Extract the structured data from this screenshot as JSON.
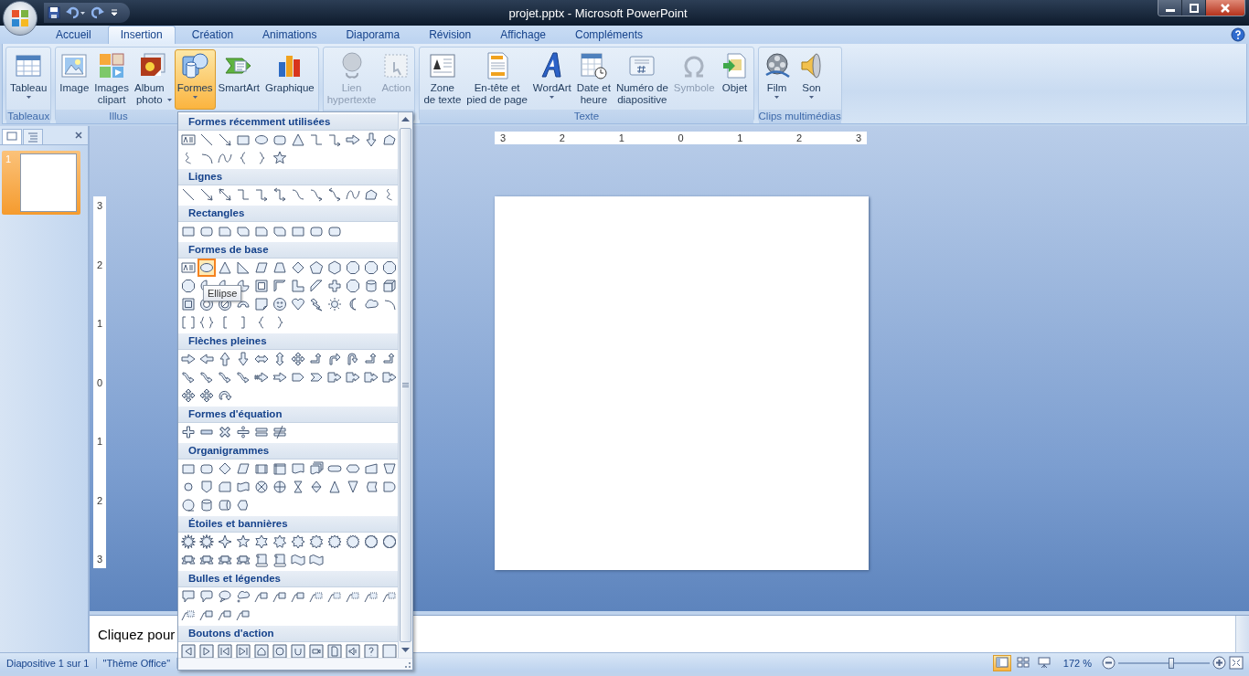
{
  "window": {
    "title": "projet.pptx - Microsoft PowerPoint"
  },
  "tabs": [
    {
      "label": "Accueil",
      "selected": false
    },
    {
      "label": "Insertion",
      "selected": true
    },
    {
      "label": "Création",
      "selected": false
    },
    {
      "label": "Animations",
      "selected": false
    },
    {
      "label": "Diaporama",
      "selected": false
    },
    {
      "label": "Révision",
      "selected": false
    },
    {
      "label": "Affichage",
      "selected": false
    },
    {
      "label": "Compléments",
      "selected": false
    }
  ],
  "ribbon": {
    "groups": [
      {
        "label": "Tableaux",
        "buttons": [
          {
            "kind": "table",
            "label": "Tableau",
            "has_menu": true,
            "disabled": false,
            "selected": false
          }
        ]
      },
      {
        "label": "Illus",
        "buttons": [
          {
            "kind": "picture",
            "label": "Image",
            "has_menu": false,
            "disabled": false,
            "selected": false
          },
          {
            "kind": "clipart",
            "label": "Images\nclipart",
            "has_menu": false,
            "disabled": false,
            "selected": false
          },
          {
            "kind": "album",
            "label": "Album\nphoto",
            "has_menu": true,
            "disabled": false,
            "selected": false
          },
          {
            "kind": "shapes",
            "label": "Formes",
            "has_menu": true,
            "disabled": false,
            "selected": true
          },
          {
            "kind": "smartart",
            "label": "SmartArt",
            "has_menu": false,
            "disabled": false,
            "selected": false
          },
          {
            "kind": "chart",
            "label": "Graphique",
            "has_menu": false,
            "disabled": false,
            "selected": false
          }
        ]
      },
      {
        "buttons": [
          {
            "kind": "link",
            "label": "Lien\nhypertexte",
            "has_menu": false,
            "disabled": true,
            "selected": false
          },
          {
            "kind": "action",
            "label": "Action",
            "has_menu": false,
            "disabled": true,
            "selected": false
          }
        ]
      },
      {
        "label": "Texte",
        "buttons": [
          {
            "kind": "textbox",
            "label": "Zone\nde texte",
            "has_menu": false,
            "disabled": false,
            "selected": false
          },
          {
            "kind": "header",
            "label": "En-tête et\npied de page",
            "has_menu": false,
            "disabled": false,
            "selected": false
          },
          {
            "kind": "wordart",
            "label": "WordArt",
            "has_menu": true,
            "disabled": false,
            "selected": false
          },
          {
            "kind": "date",
            "label": "Date et\nheure",
            "has_menu": false,
            "disabled": false,
            "selected": false
          },
          {
            "kind": "number",
            "label": "Numéro de\ndiapositive",
            "has_menu": false,
            "disabled": false,
            "selected": false
          },
          {
            "kind": "symbol",
            "label": "Symbole",
            "has_menu": false,
            "disabled": true,
            "selected": false
          },
          {
            "kind": "object",
            "label": "Objet",
            "has_menu": false,
            "disabled": false,
            "selected": false
          }
        ]
      },
      {
        "label": "Clips multimédias",
        "buttons": [
          {
            "kind": "movie",
            "label": "Film",
            "has_menu": true,
            "disabled": false,
            "selected": false
          },
          {
            "kind": "sound",
            "label": "Son",
            "has_menu": true,
            "disabled": false,
            "selected": false
          }
        ]
      }
    ]
  },
  "slides_panel": {
    "tabs": [
      {
        "kind": "slides",
        "selected": true
      },
      {
        "kind": "outline",
        "selected": false
      }
    ],
    "slides": [
      {
        "number": "1",
        "selected": true
      }
    ]
  },
  "editor": {
    "ruler_horizontal": [
      "3",
      "2",
      "1",
      "0",
      "1",
      "2",
      "3"
    ],
    "ruler_vertical": [
      "3",
      "2",
      "1",
      "0",
      "1",
      "2",
      "3"
    ]
  },
  "notes": {
    "prompt": "Cliquez pour"
  },
  "gallery": {
    "tooltip": "Ellipse",
    "sections": [
      {
        "title": "Formes récemment utilisées",
        "shapes": [
          {
            "kind": "textbox",
            "selected": false
          },
          {
            "kind": "line",
            "selected": false
          },
          {
            "kind": "arrow",
            "selected": false
          },
          {
            "kind": "rect",
            "selected": false
          },
          {
            "kind": "ellipse",
            "selected": false
          },
          {
            "kind": "rrect",
            "selected": false
          },
          {
            "kind": "triangle",
            "selected": false
          },
          {
            "kind": "elbow",
            "selected": false
          },
          {
            "kind": "elbowarrow",
            "selected": false
          },
          {
            "kind": "arrowright",
            "selected": false
          },
          {
            "kind": "arrowdown",
            "selected": false
          },
          {
            "kind": "freeform",
            "selected": false
          },
          {
            "kind": "scribble",
            "selected": false
          },
          {
            "kind": "arc",
            "selected": false
          },
          {
            "kind": "curve",
            "selected": false
          },
          {
            "kind": "lbrace",
            "selected": false
          },
          {
            "kind": "rbrace",
            "selected": false
          },
          {
            "kind": "star",
            "selected": false
          }
        ]
      },
      {
        "title": "Lignes",
        "shapes": [
          {
            "kind": "line",
            "selected": false
          },
          {
            "kind": "arrow",
            "selected": false
          },
          {
            "kind": "dblarrow",
            "selected": false
          },
          {
            "kind": "elbow",
            "selected": false
          },
          {
            "kind": "elbowarrow",
            "selected": false
          },
          {
            "kind": "elbowdbl",
            "selected": false
          },
          {
            "kind": "curved",
            "selected": false
          },
          {
            "kind": "curvedarrow",
            "selected": false
          },
          {
            "kind": "curveddbl",
            "selected": false
          },
          {
            "kind": "curve",
            "selected": false
          },
          {
            "kind": "freeform",
            "selected": false
          },
          {
            "kind": "scribble",
            "selected": false
          }
        ]
      },
      {
        "title": "Rectangles",
        "shapes": [
          {
            "kind": "rect",
            "selected": false
          },
          {
            "kind": "rrect",
            "selected": false
          },
          {
            "kind": "snip",
            "selected": false
          },
          {
            "kind": "snip2",
            "selected": false
          },
          {
            "kind": "snip",
            "selected": false
          },
          {
            "kind": "snip2",
            "selected": false
          },
          {
            "kind": "rect",
            "selected": false
          },
          {
            "kind": "rrect",
            "selected": false
          },
          {
            "kind": "rrect",
            "selected": false
          }
        ]
      },
      {
        "title": "Formes de base",
        "shapes": [
          {
            "kind": "textbox",
            "selected": false
          },
          {
            "kind": "ellipse",
            "selected": true
          },
          {
            "kind": "triangle",
            "selected": false
          },
          {
            "kind": "rtriangle",
            "selected": false
          },
          {
            "kind": "parallelogram",
            "selected": false
          },
          {
            "kind": "trapezoid",
            "selected": false
          },
          {
            "kind": "diamond",
            "selected": false
          },
          {
            "kind": "pentagon",
            "selected": false
          },
          {
            "kind": "hexagon",
            "selected": false
          },
          {
            "kind": "octagon",
            "selected": false
          },
          {
            "kind": "octagon",
            "selected": false
          },
          {
            "kind": "octagon",
            "selected": false
          },
          {
            "kind": "octagon",
            "selected": false
          },
          {
            "kind": "pie",
            "selected": false
          },
          {
            "kind": "pie",
            "selected": false
          },
          {
            "kind": "pie",
            "selected": false
          },
          {
            "kind": "frame",
            "selected": false
          },
          {
            "kind": "halfframe",
            "selected": false
          },
          {
            "kind": "lshape",
            "selected": false
          },
          {
            "kind": "diagstripe",
            "selected": false
          },
          {
            "kind": "cross",
            "selected": false
          },
          {
            "kind": "octagon",
            "selected": false
          },
          {
            "kind": "can",
            "selected": false
          },
          {
            "kind": "cube",
            "selected": false
          },
          {
            "kind": "bevel",
            "selected": false
          },
          {
            "kind": "donut",
            "selected": false
          },
          {
            "kind": "nosymbol",
            "selected": false
          },
          {
            "kind": "blockarc",
            "selected": false
          },
          {
            "kind": "folded",
            "selected": false
          },
          {
            "kind": "smiley",
            "selected": false
          },
          {
            "kind": "heart",
            "selected": false
          },
          {
            "kind": "lightning",
            "selected": false
          },
          {
            "kind": "sun",
            "selected": false
          },
          {
            "kind": "moon",
            "selected": false
          },
          {
            "kind": "cloud",
            "selected": false
          },
          {
            "kind": "arc",
            "selected": false
          },
          {
            "kind": "bracketpair",
            "selected": false
          },
          {
            "kind": "bracepair",
            "selected": false
          },
          {
            "kind": "lbracket",
            "selected": false
          },
          {
            "kind": "rbracket",
            "selected": false
          },
          {
            "kind": "lbrace",
            "selected": false
          },
          {
            "kind": "rbrace",
            "selected": false
          }
        ]
      },
      {
        "title": "Flèches pleines",
        "shapes": [
          {
            "kind": "arrowright",
            "selected": false
          },
          {
            "kind": "arrowleft",
            "selected": false
          },
          {
            "kind": "arrowup",
            "selected": false
          },
          {
            "kind": "arrowdown",
            "selected": false
          },
          {
            "kind": "arrowlr",
            "selected": false
          },
          {
            "kind": "arrowud",
            "selected": false
          },
          {
            "kind": "arrowquad",
            "selected": false
          },
          {
            "kind": "bentup",
            "selected": false
          },
          {
            "kind": "bentarrow",
            "selected": false
          },
          {
            "kind": "uturn",
            "selected": false
          },
          {
            "kind": "bentup",
            "selected": false
          },
          {
            "kind": "bentup",
            "selected": false
          },
          {
            "kind": "curvedarrowblock",
            "selected": false
          },
          {
            "kind": "curvedarrowblock",
            "selected": false
          },
          {
            "kind": "curvedarrowblock",
            "selected": false
          },
          {
            "kind": "curvedarrowblock",
            "selected": false
          },
          {
            "kind": "stripedright",
            "selected": false
          },
          {
            "kind": "notchedright",
            "selected": false
          },
          {
            "kind": "pentarrow",
            "selected": false
          },
          {
            "kind": "chevron",
            "selected": false
          },
          {
            "kind": "calloutarrow",
            "selected": false
          },
          {
            "kind": "calloutarrow",
            "selected": false
          },
          {
            "kind": "calloutarrow",
            "selected": false
          },
          {
            "kind": "calloutarrow",
            "selected": false
          },
          {
            "kind": "arrowquad",
            "selected": false
          },
          {
            "kind": "arrowquad",
            "selected": false
          },
          {
            "kind": "circulararrow",
            "selected": false
          }
        ]
      },
      {
        "title": "Formes d'équation",
        "shapes": [
          {
            "kind": "plus",
            "selected": false
          },
          {
            "kind": "minus",
            "selected": false
          },
          {
            "kind": "times",
            "selected": false
          },
          {
            "kind": "divide",
            "selected": false
          },
          {
            "kind": "equal",
            "selected": false
          },
          {
            "kind": "notequal",
            "selected": false
          }
        ]
      },
      {
        "title": "Organigrammes",
        "shapes": [
          {
            "kind": "rect",
            "selected": false
          },
          {
            "kind": "rrect",
            "selected": false
          },
          {
            "kind": "diamond",
            "selected": false
          },
          {
            "kind": "parallelogram",
            "selected": false
          },
          {
            "kind": "predefined",
            "selected": false
          },
          {
            "kind": "internal",
            "selected": false
          },
          {
            "kind": "document",
            "selected": false
          },
          {
            "kind": "multidoc",
            "selected": false
          },
          {
            "kind": "terminator",
            "selected": false
          },
          {
            "kind": "preparation",
            "selected": false
          },
          {
            "kind": "manualinput",
            "selected": false
          },
          {
            "kind": "manualop",
            "selected": false
          },
          {
            "kind": "connector",
            "selected": false
          },
          {
            "kind": "offpage",
            "selected": false
          },
          {
            "kind": "card",
            "selected": false
          },
          {
            "kind": "tape",
            "selected": false
          },
          {
            "kind": "sumjunction",
            "selected": false
          },
          {
            "kind": "or",
            "selected": false
          },
          {
            "kind": "collate",
            "selected": false
          },
          {
            "kind": "sort",
            "selected": false
          },
          {
            "kind": "extract",
            "selected": false
          },
          {
            "kind": "merge",
            "selected": false
          },
          {
            "kind": "storeddata",
            "selected": false
          },
          {
            "kind": "delay",
            "selected": false
          },
          {
            "kind": "seqaccess",
            "selected": false
          },
          {
            "kind": "can",
            "selected": false
          },
          {
            "kind": "directaccess",
            "selected": false
          },
          {
            "kind": "display",
            "selected": false
          }
        ]
      },
      {
        "title": "Étoiles et bannières",
        "shapes": [
          {
            "kind": "burst",
            "selected": false
          },
          {
            "kind": "burst",
            "selected": false
          },
          {
            "kind": "star4",
            "selected": false
          },
          {
            "kind": "star",
            "selected": false
          },
          {
            "kind": "star6",
            "selected": false
          },
          {
            "kind": "star7",
            "selected": false
          },
          {
            "kind": "star8",
            "selected": false
          },
          {
            "kind": "star10",
            "selected": false
          },
          {
            "kind": "star12",
            "selected": false
          },
          {
            "kind": "star16",
            "selected": false
          },
          {
            "kind": "star24",
            "selected": false
          },
          {
            "kind": "star32",
            "selected": false
          },
          {
            "kind": "ribbon",
            "selected": false
          },
          {
            "kind": "ribbon",
            "selected": false
          },
          {
            "kind": "ribbon",
            "selected": false
          },
          {
            "kind": "ribbon",
            "selected": false
          },
          {
            "kind": "scroll",
            "selected": false
          },
          {
            "kind": "scroll",
            "selected": false
          },
          {
            "kind": "wave",
            "selected": false
          },
          {
            "kind": "wave",
            "selected": false
          }
        ]
      },
      {
        "title": "Bulles et légendes",
        "shapes": [
          {
            "kind": "calloutrect",
            "selected": false
          },
          {
            "kind": "calloutrrect",
            "selected": false
          },
          {
            "kind": "calloutoval",
            "selected": false
          },
          {
            "kind": "calloutcloud",
            "selected": false
          },
          {
            "kind": "linecallout",
            "selected": false
          },
          {
            "kind": "linecallout",
            "selected": false
          },
          {
            "kind": "linecallout",
            "selected": false
          },
          {
            "kind": "linecalloutplain",
            "selected": false
          },
          {
            "kind": "linecalloutplain",
            "selected": false
          },
          {
            "kind": "linecalloutplain",
            "selected": false
          },
          {
            "kind": "linecalloutplain",
            "selected": false
          },
          {
            "kind": "linecalloutplain",
            "selected": false
          },
          {
            "kind": "linecalloutplain",
            "selected": false
          },
          {
            "kind": "linecallout",
            "selected": false
          },
          {
            "kind": "linecallout",
            "selected": false
          },
          {
            "kind": "linecallout",
            "selected": false
          }
        ]
      },
      {
        "title": "Boutons d'action",
        "shapes": [
          {
            "kind": "btnback",
            "selected": false
          },
          {
            "kind": "btnforward",
            "selected": false
          },
          {
            "kind": "btnbegin",
            "selected": false
          },
          {
            "kind": "btnend",
            "selected": false
          },
          {
            "kind": "btnhome",
            "selected": false
          },
          {
            "kind": "btninfo",
            "selected": false
          },
          {
            "kind": "btnreturn",
            "selected": false
          },
          {
            "kind": "btnmovie",
            "selected": false
          },
          {
            "kind": "btndoc",
            "selected": false
          },
          {
            "kind": "btnsound",
            "selected": false
          },
          {
            "kind": "btnhelp",
            "selected": false
          },
          {
            "kind": "btnblank",
            "selected": false
          }
        ]
      }
    ]
  },
  "status_bar": {
    "items": [
      "Diapositive 1 sur 1",
      "\"Thème Office\""
    ],
    "views": [
      {
        "kind": "normal",
        "selected": true
      },
      {
        "kind": "sorter",
        "selected": false
      },
      {
        "kind": "show",
        "selected": false
      }
    ],
    "zoom": "172 %",
    "zoom_slider": {
      "level": 0.58
    }
  }
}
